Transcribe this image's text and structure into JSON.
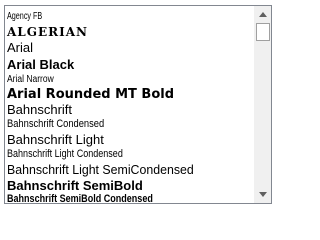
{
  "font_list": {
    "items": [
      "Agency FB",
      "ALGERIAN",
      "Arial",
      "Arial Black",
      "Arial Narrow",
      "Arial Rounded MT Bold",
      "Bahnschrift",
      "Bahnschrift Condensed",
      "Bahnschrift Light",
      "Bahnschrift Light Condensed",
      "Bahnschrift Light SemiCondensed",
      "Bahnschrift SemiBold",
      "Bahnschrift SemiBold Condensed"
    ]
  },
  "scrollbar": {
    "up_icon": "scroll-up-arrow-icon",
    "down_icon": "scroll-down-arrow-icon",
    "position": 0
  }
}
